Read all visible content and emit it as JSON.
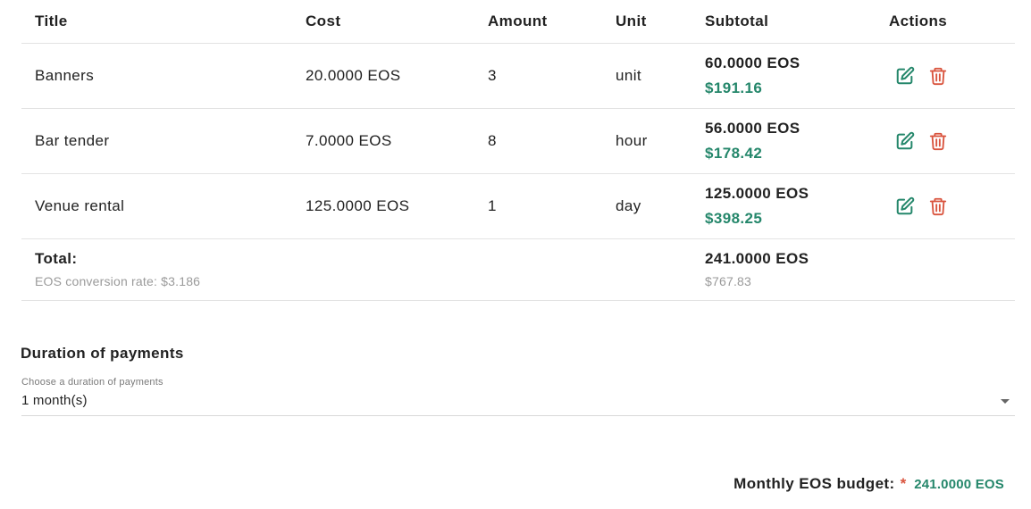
{
  "table": {
    "headers": {
      "title": "Title",
      "cost": "Cost",
      "amount": "Amount",
      "unit": "Unit",
      "subtotal": "Subtotal",
      "actions": "Actions"
    },
    "rows": [
      {
        "title": "Banners",
        "cost": "20.0000 EOS",
        "amount": "3",
        "unit": "unit",
        "subtotal_eos": "60.0000 EOS",
        "subtotal_usd": "$191.16"
      },
      {
        "title": "Bar tender",
        "cost": "7.0000 EOS",
        "amount": "8",
        "unit": "hour",
        "subtotal_eos": "56.0000 EOS",
        "subtotal_usd": "$178.42"
      },
      {
        "title": "Venue rental",
        "cost": "125.0000 EOS",
        "amount": "1",
        "unit": "day",
        "subtotal_eos": "125.0000 EOS",
        "subtotal_usd": "$398.25"
      }
    ],
    "total": {
      "label": "Total:",
      "conversion": "EOS conversion rate: $3.186",
      "eos": "241.0000 EOS",
      "usd": "$767.83"
    },
    "icons": {
      "edit": "edit-icon",
      "delete": "trash-icon"
    }
  },
  "duration": {
    "title": "Duration of payments",
    "label": "Choose a duration of payments",
    "value": "1 month(s)"
  },
  "monthly": {
    "label": "Monthly EOS budget:",
    "required_mark": "*",
    "value": "241.0000 EOS"
  },
  "colors": {
    "accent_green": "#25876b",
    "delete_red": "#d9533d",
    "divider": "#e3e3e3"
  }
}
